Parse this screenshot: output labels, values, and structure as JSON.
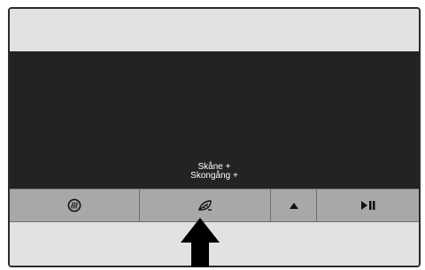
{
  "program": {
    "line1": "Skåne +",
    "line2": "Skongång +"
  },
  "buttons": [
    {
      "icon": "defrost-icon"
    },
    {
      "icon": "feather-icon"
    },
    {
      "icon": "up-triangle-icon"
    },
    {
      "icon": "play-pause-icon"
    }
  ],
  "colors": {
    "display": "#232323",
    "button_bar": "#a8a8a8",
    "panel": "#e2e2e2"
  }
}
